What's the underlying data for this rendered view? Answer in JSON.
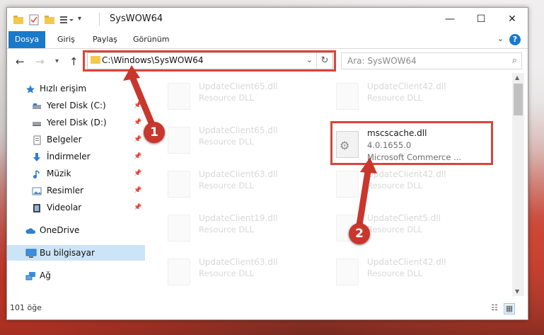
{
  "window": {
    "title": "SysWOW64",
    "controls": {
      "minimize": "—",
      "maximize": "☐",
      "close": "✕"
    }
  },
  "ribbon": {
    "tabs": [
      "Dosya",
      "Giriş",
      "Paylaş",
      "Görünüm"
    ],
    "help": "?"
  },
  "nav": {
    "back": "←",
    "forward": "→",
    "recent": "▾",
    "up": "↑",
    "address": "C:\\Windows\\SysWOW64",
    "search_placeholder": "Ara: SysWOW64"
  },
  "sidebar": {
    "items": [
      {
        "label": "Hızlı erişim",
        "icon": "star-icon",
        "pinned": false
      },
      {
        "label": "Yerel Disk (C:)",
        "icon": "drive-icon",
        "pinned": true
      },
      {
        "label": "Yerel Disk (D:)",
        "icon": "drive-icon",
        "pinned": true
      },
      {
        "label": "Belgeler",
        "icon": "documents-icon",
        "pinned": true
      },
      {
        "label": "İndirmeler",
        "icon": "download-icon",
        "pinned": true
      },
      {
        "label": "Müzik",
        "icon": "music-icon",
        "pinned": true
      },
      {
        "label": "Resimler",
        "icon": "pictures-icon",
        "pinned": true
      },
      {
        "label": "Videolar",
        "icon": "video-icon",
        "pinned": true
      },
      {
        "label": "OneDrive",
        "icon": "cloud-icon",
        "pinned": false
      },
      {
        "label": "Bu bilgisayar",
        "icon": "computer-icon",
        "pinned": false,
        "selected": true
      },
      {
        "label": "Ağ",
        "icon": "network-icon",
        "pinned": false
      }
    ]
  },
  "files": {
    "left_column": [
      {
        "name": "UpdateClient65.dll",
        "type": "Resource DLL"
      },
      {
        "name": "UpdateClient65.dll",
        "type": "Resource DLL"
      },
      {
        "name": "UpdateClient63.dll",
        "type": "Resource DLL"
      },
      {
        "name": "UpdateClient19.dll",
        "type": "Resource DLL"
      },
      {
        "name": "UpdateClient63.dll",
        "type": "Resource DLL"
      }
    ],
    "right_column": [
      {
        "name": "UpdateClient42.dll",
        "type": "Resource DLL"
      },
      {
        "name": "UpdateClient42.dll",
        "type": "Resource DLL"
      },
      {
        "name": "UpdateClient5.dll",
        "type": "Resource DLL"
      },
      {
        "name": "UpdateClient42.dll",
        "type": "Resource DLL"
      }
    ],
    "highlighted": {
      "name": "mscscache.dll",
      "version": "4.0.1655.0",
      "description": "Microsoft Commerce ..."
    }
  },
  "status": {
    "count": "101 öğe"
  },
  "callouts": [
    "1",
    "2"
  ],
  "colors": {
    "accent": "#1979ca",
    "highlight": "#d9453a",
    "selected": "#cce4f7"
  }
}
